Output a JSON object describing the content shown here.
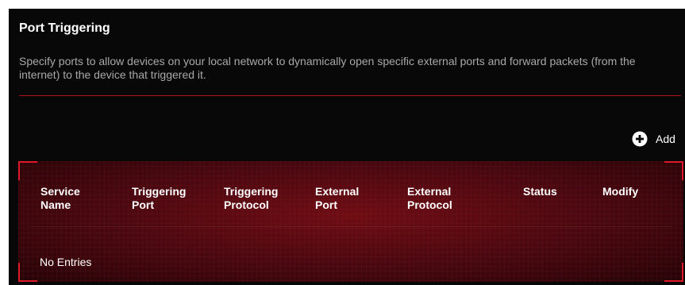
{
  "section": {
    "title": "Port Triggering",
    "description": "Specify ports to allow devices on your local network to dynamically open specific external ports and forward packets (from the internet) to the device that triggered it."
  },
  "toolbar": {
    "add_label": "Add",
    "add_icon": "plus-circle-icon"
  },
  "table": {
    "columns": [
      "Service\nName",
      "Triggering\nPort",
      "Triggering\nProtocol",
      "External\nPort",
      "External\nProtocol",
      "Status",
      "Modify"
    ],
    "empty_text": "No Entries"
  },
  "colors": {
    "accent": "#e0192a",
    "panel_bg": "#080808",
    "text_primary": "#ffffff",
    "text_muted": "#a8a8a8"
  }
}
